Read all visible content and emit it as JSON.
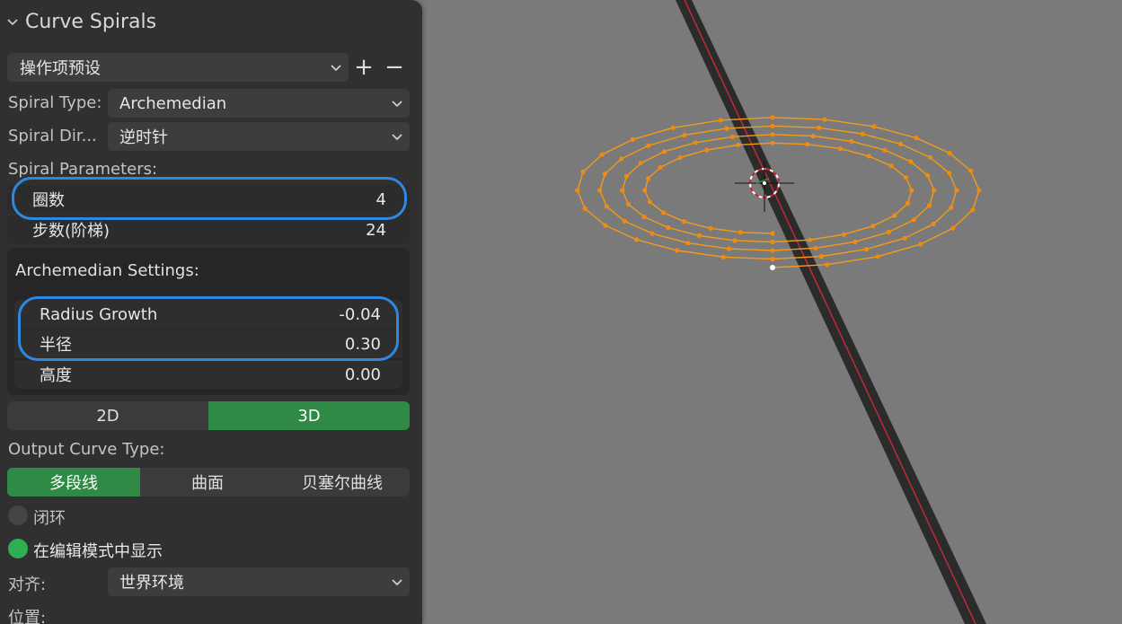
{
  "panel": {
    "title": "Curve Spirals",
    "preset": {
      "value": "操作项预设",
      "add_label": "+",
      "remove_label": "−"
    },
    "spiral_type": {
      "label": "Spiral Type:",
      "value": "Archemedian"
    },
    "spiral_direction": {
      "label": "Spiral Dir...",
      "value": "逆时针"
    },
    "spiral_parameters": {
      "label": "Spiral Parameters:",
      "turns": {
        "label": "圈数",
        "value": "4"
      },
      "steps": {
        "label": "步数(阶梯)",
        "value": "24"
      }
    },
    "archemedian_settings": {
      "label": "Archemedian Settings:",
      "radius_growth": {
        "label": "Radius Growth",
        "value": "-0.04"
      },
      "radius": {
        "label": "半径",
        "value": "0.30"
      },
      "height": {
        "label": "高度",
        "value": "0.00"
      }
    },
    "dimension_toggle": {
      "options": [
        "2D",
        "3D"
      ],
      "selected": "3D"
    },
    "output_curve_type": {
      "label": "Output Curve Type:",
      "options": [
        "多段线",
        "曲面",
        "贝塞尔曲线"
      ],
      "selected": "多段线"
    },
    "cyclic": {
      "label": "闭环",
      "checked": false
    },
    "show_in_edit_mode": {
      "label": "在编辑模式中显示",
      "checked": true
    },
    "align": {
      "label": "对齐:",
      "value": "世界环境"
    },
    "location": {
      "label": "位置:"
    }
  },
  "colors": {
    "accent_green": "#2f8a45",
    "highlight_blue": "#2e88e0",
    "spiral_orange": "#f29a1a",
    "axis_red": "#c22a3a"
  }
}
